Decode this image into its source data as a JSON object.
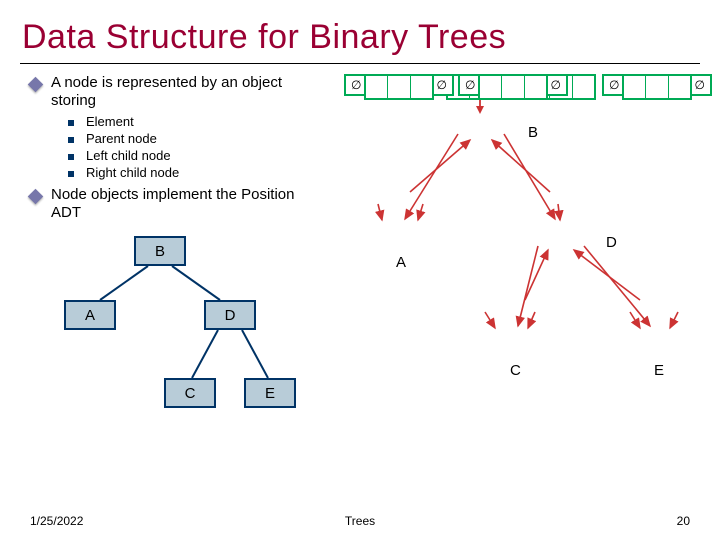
{
  "title": "Data Structure for Binary Trees",
  "bullets": {
    "b1": "A node is represented by an object storing",
    "sub": [
      "Element",
      "Parent node",
      "Left child node",
      "Right child node"
    ],
    "b2": "Node objects implement the Position ADT"
  },
  "ltree": {
    "B": "B",
    "A": "A",
    "D": "D",
    "C": "C",
    "E": "E"
  },
  "rtree": {
    "empty": "∅",
    "labels": {
      "B": "B",
      "A": "A",
      "D": "D",
      "C": "C",
      "E": "E"
    }
  },
  "footer": {
    "date": "1/25/2022",
    "center": "Trees",
    "page": "20"
  }
}
